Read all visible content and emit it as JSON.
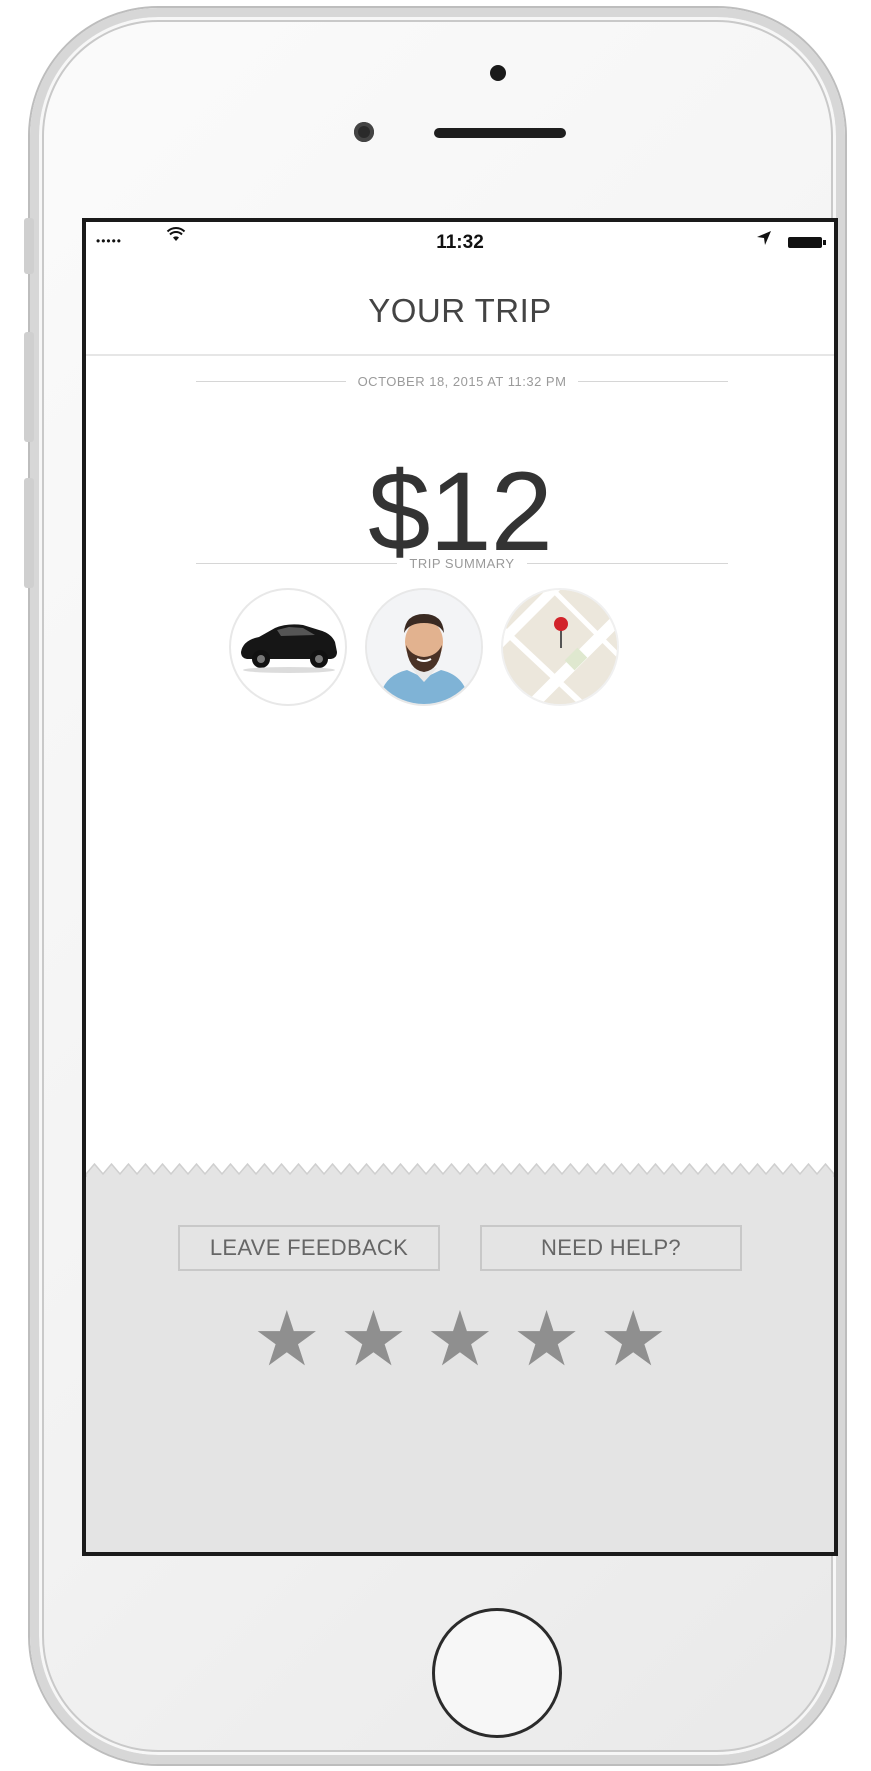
{
  "status_bar": {
    "signal": "•••••",
    "time": "11:32"
  },
  "nav": {
    "title": "YOUR TRIP"
  },
  "receipt": {
    "date_label": "OCTOBER 18, 2015 AT 11:32 PM",
    "fare": "$12",
    "summary_label": "TRIP SUMMARY"
  },
  "summary_icons": [
    "car-icon",
    "driver-avatar",
    "map-icon"
  ],
  "actions": {
    "leave_feedback": "LEAVE FEEDBACK",
    "need_help": "NEED HELP?"
  },
  "rating": {
    "stars": [
      "★",
      "★",
      "★",
      "★",
      "★"
    ],
    "selected": 0,
    "max": 5
  },
  "colors": {
    "footer_bg": "#e4e4e4",
    "star": "#8f8f8f",
    "text_dark": "#333333"
  }
}
